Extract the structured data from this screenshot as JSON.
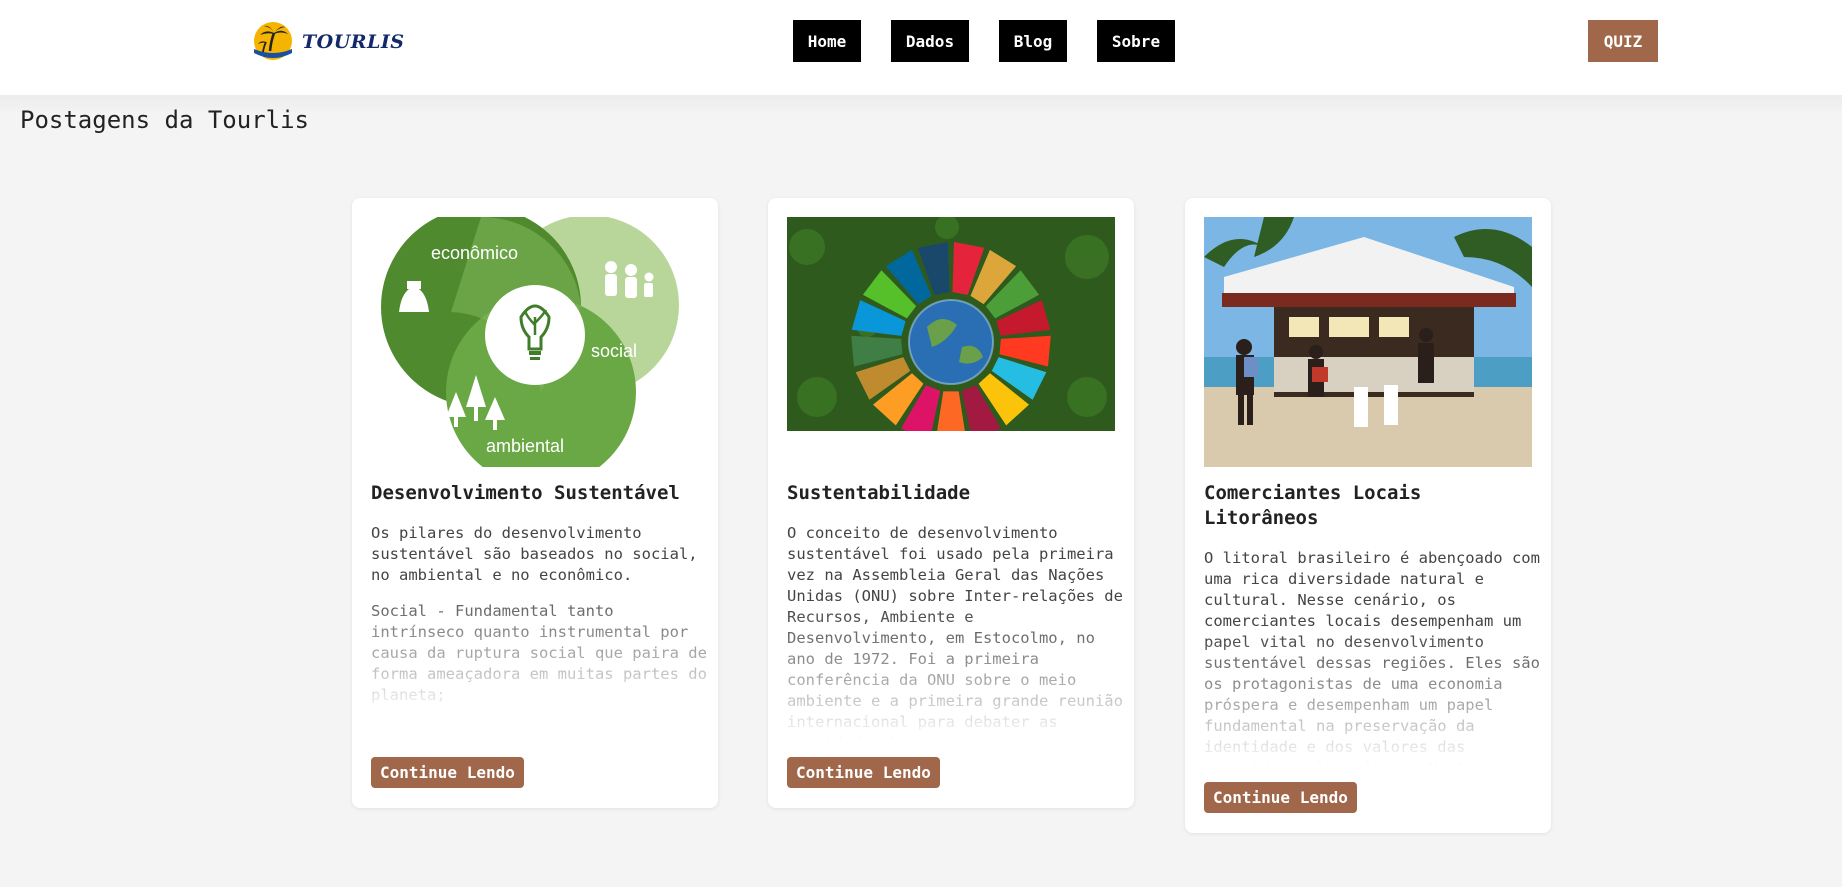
{
  "header": {
    "logo_text": "TOURLIS",
    "nav": [
      {
        "label": "Home"
      },
      {
        "label": "Dados"
      },
      {
        "label": "Blog"
      },
      {
        "label": "Sobre"
      }
    ],
    "quiz_label": "QUIZ"
  },
  "page": {
    "title": "Postagens da Tourlis"
  },
  "posts": [
    {
      "title": "Desenvolvimento Sustentável",
      "image_labels": {
        "economico": "econômico",
        "social": "social",
        "ambiental": "ambiental"
      },
      "paragraphs": [
        "Os pilares do desenvolvimento sustentável são baseados no social, no ambiental e no econômico.",
        "Social - Fundamental tanto intrínseco quanto instrumental por causa da ruptura social que paira de forma ameaçadora em muitas partes do planeta;"
      ],
      "button": "Continue Lendo"
    },
    {
      "title": "Sustentabilidade",
      "paragraphs": [
        "O conceito de desenvolvimento sustentável foi usado pela primeira vez na Assembleia Geral das Nações Unidas (ONU) sobre Inter-relações de Recursos, Ambiente e Desenvolvimento, em Estocolmo, no ano de 1972. Foi a primeira conferência da ONU sobre o meio ambiente e a primeira grande reunião internacional para debater as atividades humanas em"
      ],
      "button": "Continue Lendo"
    },
    {
      "title": "Comerciantes Locais Litorâneos",
      "paragraphs": [
        "O litoral brasileiro é abençoado com uma rica diversidade natural e cultural. Nesse cenário, os comerciantes locais desempenham um papel vital no desenvolvimento sustentável dessas regiões. Eles são os protagonistas de uma economia próspera e desempenham um papel fundamental na preservação da identidade e dos valores das comunidades litorâneas. Neste"
      ],
      "button": "Continue Lendo"
    }
  ],
  "colors": {
    "nav_bg": "#000000",
    "accent": "#a0674a",
    "logo_text": "#13296b"
  }
}
